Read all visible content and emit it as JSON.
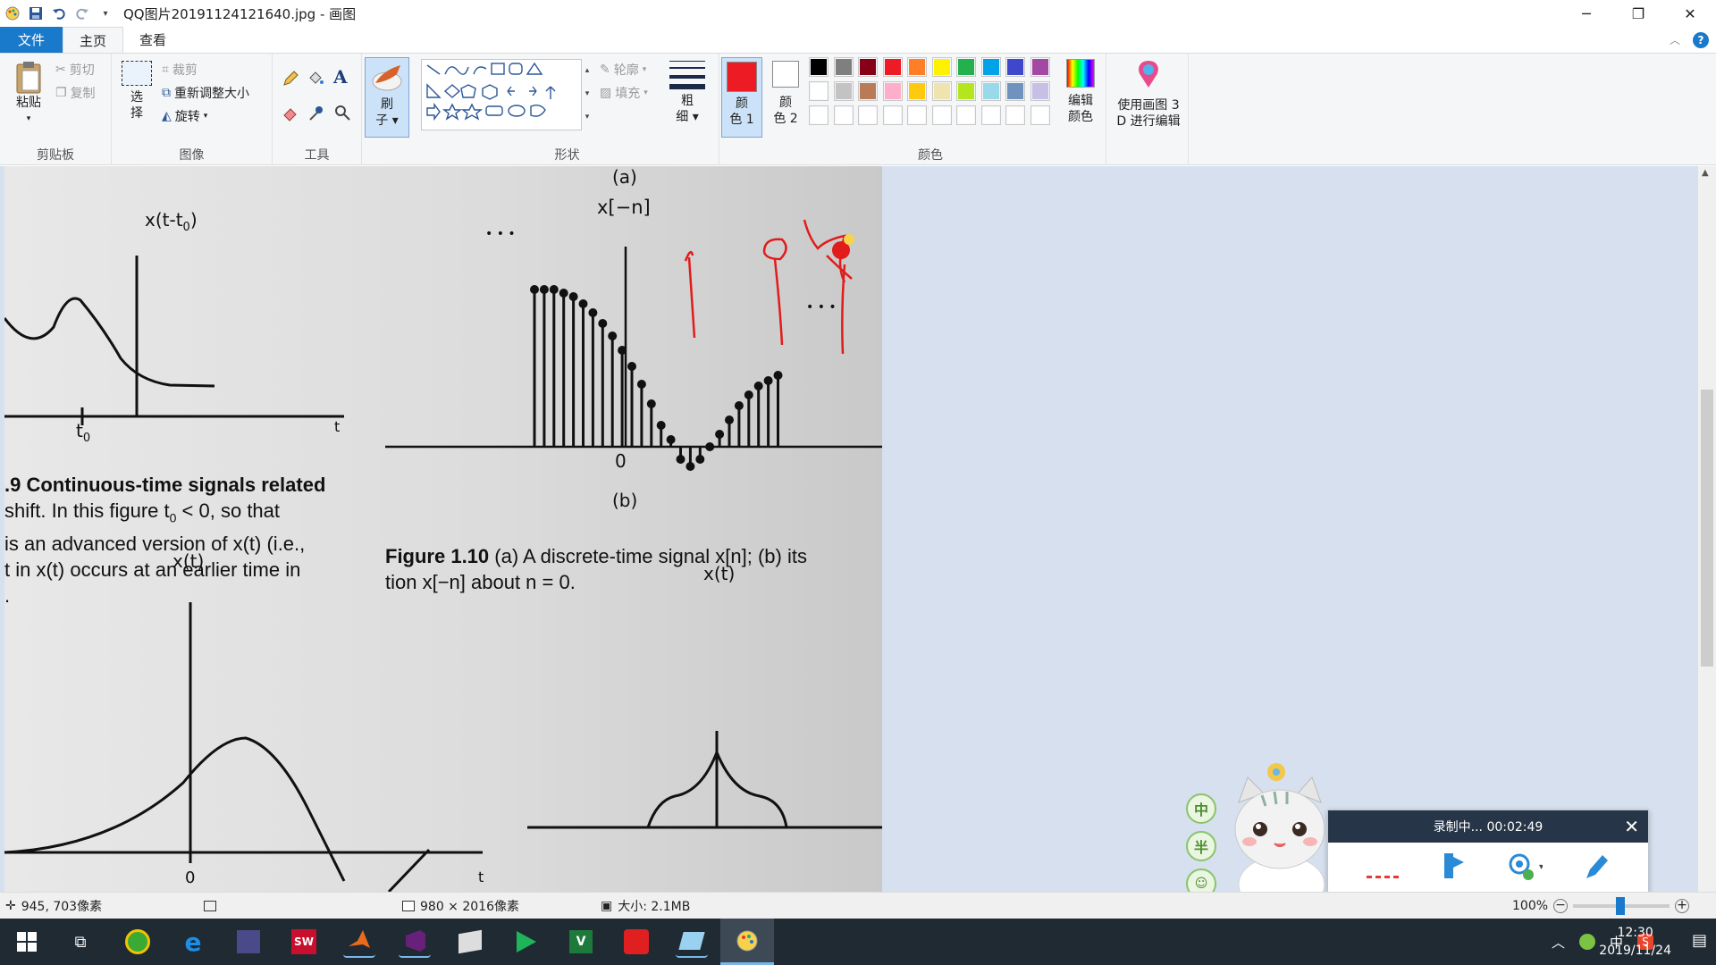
{
  "window": {
    "title": "QQ图片20191124121640.jpg - 画图"
  },
  "tabs": {
    "file": "文件",
    "home": "主页",
    "view": "查看"
  },
  "ribbon": {
    "clipboard": {
      "paste": "粘贴",
      "cut": "剪切",
      "copy": "复制",
      "label": "剪贴板"
    },
    "image": {
      "select_line1": "选",
      "select_line2": "择",
      "crop": "裁剪",
      "resize": "重新调整大小",
      "rotate": "旋转",
      "label": "图像"
    },
    "tools": {
      "label": "工具",
      "text_tool": "A"
    },
    "brushes": {
      "line1": "刷",
      "line2": "子"
    },
    "shapes": {
      "outline": "轮廓",
      "fill": "填充",
      "label": "形状"
    },
    "size": {
      "line1": "粗",
      "line2": "细"
    },
    "color1": {
      "line1": "颜",
      "line2": "色 1"
    },
    "color2": {
      "line1": "颜",
      "line2": "色 2"
    },
    "colors": {
      "label": "颜色",
      "edit_line1": "编辑",
      "edit_line2": "颜色",
      "palette_row1": [
        "#000000",
        "#7f7f7f",
        "#880015",
        "#ed1c24",
        "#ff7f27",
        "#fff200",
        "#22b14c",
        "#00a2e8",
        "#3f48cc",
        "#a349a4"
      ],
      "palette_row2": [
        "#ffffff",
        "#c3c3c3",
        "#b97a57",
        "#ffaec9",
        "#ffc90e",
        "#efe4b0",
        "#b5e61d",
        "#99d9ea",
        "#7092be",
        "#c8bfe7"
      ]
    },
    "paint3d": {
      "line1": "使用画图 3",
      "line2": "D 进行编辑"
    }
  },
  "accent": "#1979ca",
  "color1_value": "#ed1c24",
  "status": {
    "cursor": "945, 703像素",
    "dimensions": "980 × 2016像素",
    "size": "大小: 2.1MB",
    "zoom": "100%"
  },
  "recording": {
    "title": "录制中... 00:02:49"
  },
  "ime": {
    "zhong": "中",
    "ban": "半"
  },
  "taskbar": {
    "time": "12:30",
    "date": "2019/11/24",
    "ime_indicator": "中",
    "apps": [
      "windows-start-icon",
      "task-view-icon",
      "360-browser-icon",
      "edge-icon",
      "calculator-icon",
      "solidworks-icon",
      "matlab-icon",
      "visual-studio-icon",
      "book-reader-icon",
      "video-player-icon",
      "excel-like-icon",
      "app-red-icon",
      "notes-icon",
      "paint-icon"
    ]
  },
  "figure": {
    "label_a": "(a)",
    "label_b": "(b)",
    "x_t_t0": "x(t-t",
    "x_t_t0_sub": "0",
    "x_t_t0_close": ")",
    "x_neg_n": "x[−n]",
    "t0": "t",
    "t0_sub": "0",
    "t_axis": "t",
    "zero": "0",
    "dots": "• • •",
    "fig19_lines": [
      ".9   Continuous-time signals related",
      "shift. In this figure t",
      "is an advanced version of x(t) (i.e.,",
      "t in x(t) occurs at an earlier time in",
      "."
    ],
    "fig19_line2_tail": " < 0, so that",
    "fig19_line2_sub": "0",
    "fig110_bold": "Figure 1.10",
    "fig110_text": "   (a) A discrete-time signal x[n]; (b) its",
    "fig110_line2": "tion x[−n] about n = 0.",
    "x_t": "x(t)",
    "x_t_right": "x(t)"
  }
}
